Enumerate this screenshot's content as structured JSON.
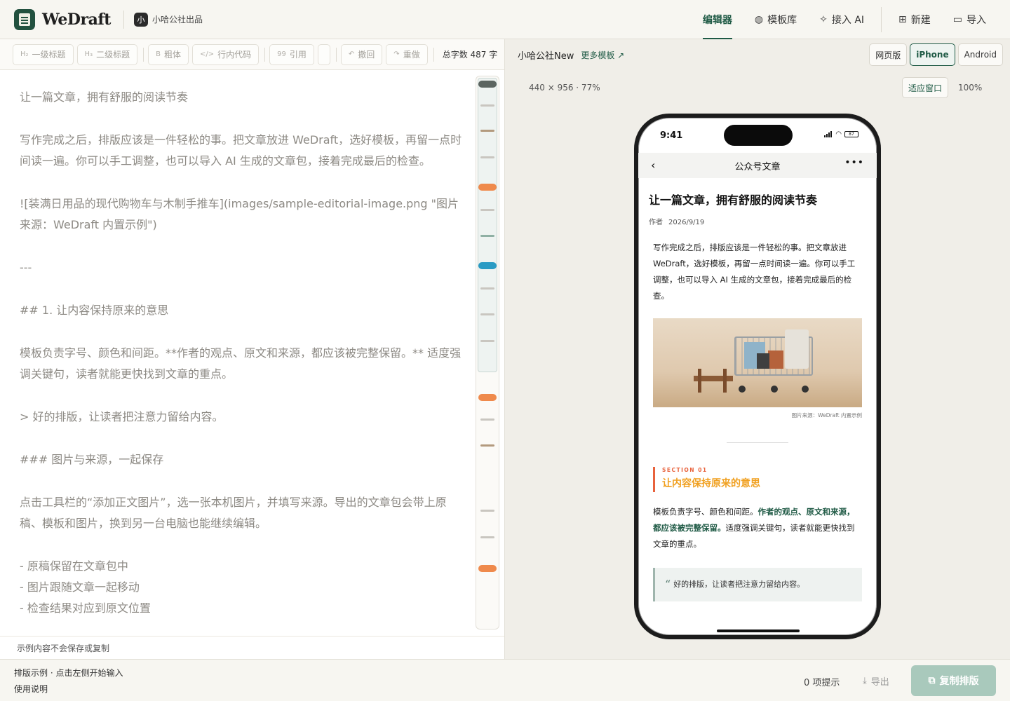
{
  "header": {
    "app_name": "WeDraft",
    "brand_badge": "小",
    "brand": "小哈公社出品",
    "nav": [
      {
        "label": "编辑器",
        "icon": "edit-icon",
        "glyph": ""
      },
      {
        "label": "模板库",
        "icon": "palette-icon",
        "glyph": "◍"
      },
      {
        "label": "接入 AI",
        "icon": "sparkle-icon",
        "glyph": "✧"
      },
      {
        "label": "新建",
        "icon": "new-file-icon",
        "glyph": "⊞"
      },
      {
        "label": "导入",
        "icon": "folder-icon",
        "glyph": "▭"
      }
    ]
  },
  "toolbar": {
    "buttons": [
      {
        "label": "一级标题",
        "glyph": "H₂"
      },
      {
        "label": "二级标题",
        "glyph": "H₃"
      },
      {
        "label": "粗体",
        "glyph": "B"
      },
      {
        "label": "行内代码",
        "glyph": "</>"
      },
      {
        "label": "引用",
        "glyph": "99"
      },
      {
        "label": "撤回",
        "glyph": "↶"
      },
      {
        "label": "重做",
        "glyph": "↷"
      }
    ],
    "word_count": "总字数 487 字"
  },
  "editor": {
    "lines": [
      "让一篇文章，拥有舒服的阅读节奏",
      "",
      "写作完成之后，排版应该是一件轻松的事。把文章放进 WeDraft，选好模板，再留一点时间读一遍。你可以手工调整，也可以导入 AI 生成的文章包，接着完成最后的检查。",
      "",
      "![装满日用品的现代购物车与木制手推车](images/sample-editorial-image.png \"图片来源：WeDraft 内置示例\")",
      "",
      "---",
      "",
      "## 1. 让内容保持原来的意思",
      "",
      "模板负责字号、颜色和间距。**作者的观点、原文和来源，都应该被完整保留。** 适度强调关键句，读者就能更快找到文章的重点。",
      "",
      "> 好的排版，让读者把注意力留给内容。",
      "",
      "### 图片与来源，一起保存",
      "",
      "点击工具栏的“添加正文图片”，选一张本机图片，并填写来源。导出的文章包会带上原稿、模板和图片，换到另一台电脑也能继续编辑。",
      "",
      "- 原稿保留在文章包中",
      "- 图片跟随文章一起移动",
      "- 检查结果对应到原文位置"
    ],
    "footer_note": "示例内容不会保存或复制"
  },
  "preview": {
    "template_name": "小哈公社New",
    "more_templates": "更多模板 ↗",
    "devices": [
      "网页版",
      "iPhone",
      "Android"
    ],
    "active_device": "iPhone",
    "size_info": "440 × 956 · 77%",
    "fit_window": "适应窗口",
    "zoom": "100%",
    "phone": {
      "time": "9:41",
      "battery": "87",
      "nav_title": "公众号文章",
      "back": "‹",
      "more": "•••",
      "article_title": "让一篇文章，拥有舒服的阅读节奏",
      "author": "作者",
      "date": "2026/9/19",
      "para1": "写作完成之后，排版应该是一件轻松的事。把文章放进 WeDraft，选好模板，再留一点时间读一遍。你可以手工调整，也可以导入 AI 生成的文章包，接着完成最后的检查。",
      "image_caption": "图片来源：WeDraft 内置示例",
      "section_tag": "SECTION 01",
      "section_title": "让内容保持原来的意思",
      "para2_a": "模板负责字号、颜色和间距。",
      "para2_bold": "作者的观点、原文和来源，都应该被完整保留。",
      "para2_b": "适度强调关键句，读者就能更快找到文章的重点。",
      "quote_mark": "“",
      "quote": "好的排版，让读者把注意力留给内容。"
    }
  },
  "footer": {
    "line1": "排版示例 · 点击左侧开始输入",
    "line2": "使用说明",
    "hints": "0 项提示",
    "export": "导出",
    "copy": "复制排版"
  },
  "colors": {
    "accent": "#1f5a45",
    "section_orange": "#e8623c",
    "section_title": "#f0a020",
    "minimap_orange": "#ef8a4c",
    "minimap_blue": "#2a9bc4",
    "minimap_green": "#8fb0a4",
    "minimap_brown": "#b39a7e",
    "minimap_gray": "#c9c6c0"
  }
}
